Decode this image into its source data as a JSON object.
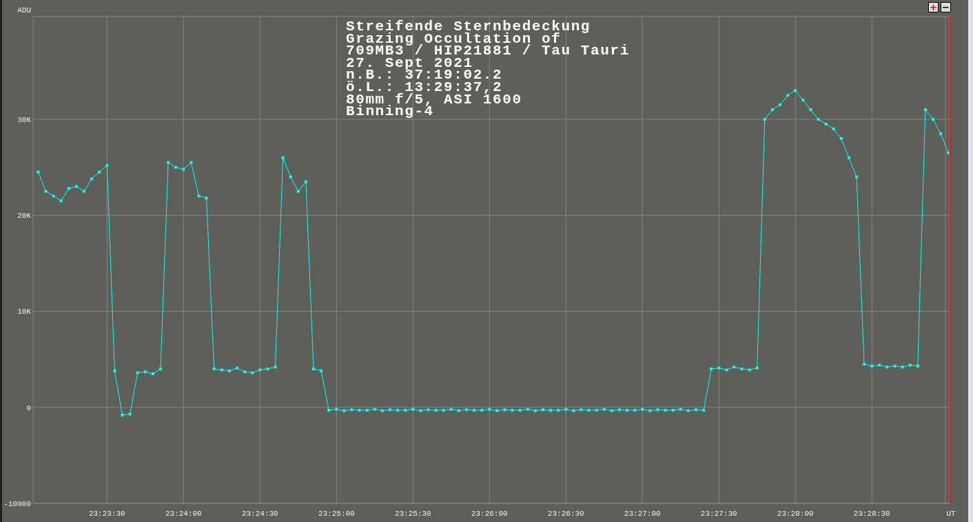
{
  "zoom_buttons": [
    "+",
    "−"
  ],
  "caption_lines": [
    "Streifende Sternbedeckung",
    "Grazing Occultation of",
    "709MB3 / HIP21881 / Tau Tauri",
    "27. Sept 2021",
    "n.B.: 37:19:02.2",
    "ö.L.: 13:29:37,2",
    "80mm f/5, ASI 1600",
    "Binning-4"
  ],
  "chart_data": {
    "type": "line",
    "ylabel": "ADU",
    "xlabel": "UT",
    "grid": true,
    "ylim": [
      -10000,
      40700
    ],
    "yticks": [
      {
        "value": -10000,
        "label": "-10000"
      },
      {
        "value": 0,
        "label": "0"
      },
      {
        "value": 10000,
        "label": "10K"
      },
      {
        "value": 20000,
        "label": "20K"
      },
      {
        "value": 30000,
        "label": "30K"
      }
    ],
    "categories": [
      null,
      null,
      null,
      null,
      null,
      null,
      null,
      null,
      null,
      "23:23:30",
      null,
      null,
      null,
      null,
      null,
      null,
      null,
      null,
      null,
      "23:24:00",
      null,
      null,
      null,
      null,
      null,
      null,
      null,
      null,
      null,
      "23:24:30",
      null,
      null,
      null,
      null,
      null,
      null,
      null,
      null,
      null,
      "23:25:00",
      null,
      null,
      null,
      null,
      null,
      null,
      null,
      null,
      null,
      "23:25:30",
      null,
      null,
      null,
      null,
      null,
      null,
      null,
      null,
      null,
      "23:26:00",
      null,
      null,
      null,
      null,
      null,
      null,
      null,
      null,
      null,
      "23:26:30",
      null,
      null,
      null,
      null,
      null,
      null,
      null,
      null,
      null,
      "23:27:00",
      null,
      null,
      null,
      null,
      null,
      null,
      null,
      null,
      null,
      "23:27:30",
      null,
      null,
      null,
      null,
      null,
      null,
      null,
      null,
      null,
      "23:28:00",
      null,
      null,
      null,
      null,
      null,
      null,
      null,
      null,
      null,
      "23:28:30",
      null,
      null,
      null,
      null,
      null,
      null,
      null,
      null,
      null,
      null
    ],
    "series": [
      {
        "color": "#00ffff",
        "marker": "square",
        "values": [
          24500,
          22500,
          22000,
          21500,
          22800,
          23000,
          22500,
          23800,
          24500,
          25200,
          3800,
          -800,
          -700,
          3600,
          3700,
          3500,
          4000,
          25500,
          25000,
          24800,
          25500,
          22000,
          21800,
          4000,
          3900,
          3800,
          4100,
          3700,
          3600,
          3900,
          4000,
          4200,
          26000,
          24000,
          22500,
          23500,
          4000,
          3800,
          -300,
          -200,
          -350,
          -250,
          -300,
          -300,
          -200,
          -350,
          -250,
          -300,
          -300,
          -200,
          -350,
          -250,
          -300,
          -300,
          -200,
          -350,
          -250,
          -300,
          -300,
          -200,
          -350,
          -250,
          -300,
          -300,
          -200,
          -350,
          -250,
          -300,
          -300,
          -200,
          -350,
          -250,
          -300,
          -300,
          -200,
          -350,
          -250,
          -300,
          -300,
          -200,
          -350,
          -250,
          -300,
          -300,
          -200,
          -350,
          -250,
          -300,
          4000,
          4100,
          3900,
          4200,
          4000,
          3900,
          4100,
          30000,
          31000,
          31500,
          32500,
          33000,
          32000,
          31000,
          30000,
          29500,
          29000,
          28000,
          26000,
          24000,
          4500,
          4300,
          4400,
          4200,
          4300,
          4200,
          4400,
          4300,
          31000,
          30000,
          28500,
          26500
        ]
      }
    ]
  }
}
